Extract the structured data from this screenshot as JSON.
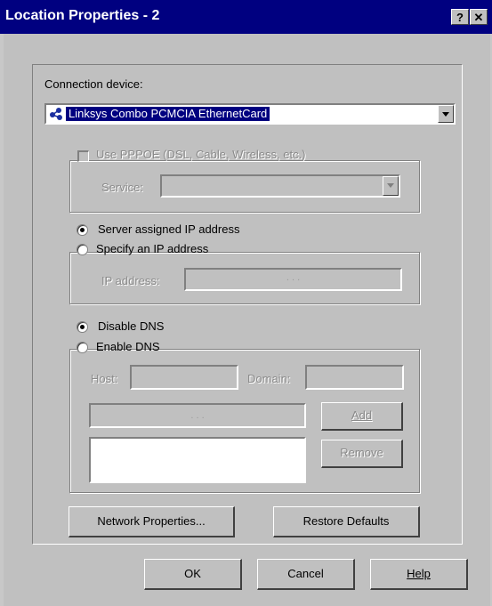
{
  "window": {
    "title": "Location Properties - 2",
    "help_glyph": "?",
    "close_glyph": "✕"
  },
  "connection": {
    "label": "Connection device:",
    "selected": "Linksys Combo PCMCIA EthernetCard",
    "icon": "network-adapter-icon"
  },
  "pppoe": {
    "checkbox_label": "Use PPPOE (DSL, Cable, Wireless, etc.)",
    "checked": false,
    "enabled": false,
    "service_label": "Service:",
    "service_value": ""
  },
  "ip": {
    "option_server": "Server assigned IP address",
    "option_specify": "Specify an IP address",
    "selected": "server",
    "ip_label": "IP address:",
    "ip_value": ".      .      ."
  },
  "dns": {
    "option_disable": "Disable DNS",
    "option_enable": "Enable DNS",
    "selected": "disable",
    "host_label": "Host:",
    "host_value": "",
    "domain_label": "Domain:",
    "domain_value": "",
    "server_ip_value": ".      .      .",
    "add_label": "Add",
    "remove_label": "Remove"
  },
  "buttons": {
    "network_properties": "Network Properties...",
    "restore_defaults": "Restore Defaults",
    "ok": "OK",
    "cancel": "Cancel",
    "help": "Help"
  },
  "colors": {
    "title_bar": "#000080",
    "face": "#c0c0c0",
    "selection": "#000080",
    "disabled_text": "#8a8a8a"
  }
}
